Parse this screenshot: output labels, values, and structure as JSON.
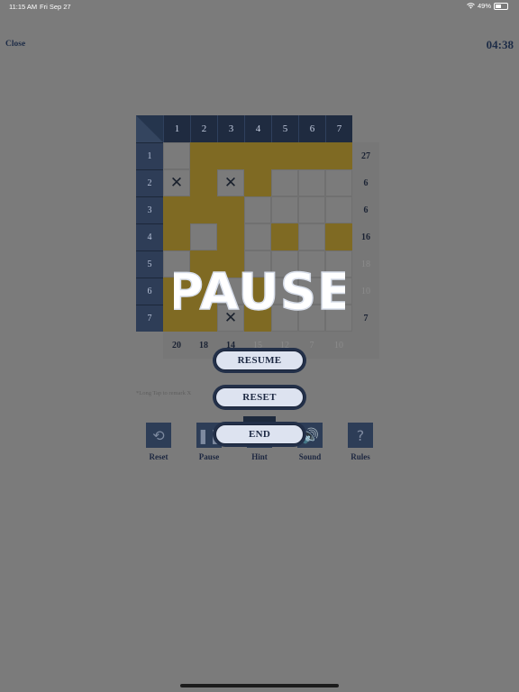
{
  "status_bar": {
    "time": "11:15 AM",
    "date": "Fri Sep 27",
    "battery": "49%",
    "battery_level": 0.49
  },
  "header": {
    "close_label": "Close",
    "timer": "04:38"
  },
  "grid": {
    "col_headers": [
      "1",
      "2",
      "3",
      "4",
      "5",
      "6",
      "7"
    ],
    "row_headers": [
      "1",
      "2",
      "3",
      "4",
      "5",
      "6",
      "7"
    ],
    "row_sums": [
      "27",
      "6",
      "6",
      "16",
      "18",
      "10",
      "7"
    ],
    "row_sums_dim": [
      false,
      false,
      false,
      false,
      true,
      true,
      false
    ],
    "col_sums": [
      "20",
      "18",
      "14",
      "15",
      "12",
      "7",
      "10"
    ],
    "col_sums_dim": [
      false,
      false,
      false,
      true,
      true,
      true,
      true
    ],
    "cells": [
      [
        0,
        1,
        1,
        1,
        1,
        1,
        1
      ],
      [
        2,
        1,
        2,
        1,
        0,
        0,
        0
      ],
      [
        1,
        1,
        1,
        0,
        0,
        0,
        0
      ],
      [
        1,
        0,
        1,
        0,
        1,
        0,
        1
      ],
      [
        0,
        1,
        1,
        0,
        0,
        0,
        0
      ],
      [
        1,
        1,
        0,
        1,
        0,
        0,
        0
      ],
      [
        1,
        1,
        2,
        1,
        0,
        0,
        0
      ]
    ]
  },
  "note": "*Long Tap to remark X",
  "toolbar": [
    {
      "label": "Reset",
      "icon": "reset-icon",
      "glyph": "⟲"
    },
    {
      "label": "Pause",
      "icon": "pause-icon",
      "glyph": "❚❚"
    },
    {
      "label": "Hint",
      "icon": "hint-icon",
      "glyph": ""
    },
    {
      "label": "Sound",
      "icon": "sound-icon",
      "glyph": "🔊"
    },
    {
      "label": "Rules",
      "icon": "rules-icon",
      "glyph": "?"
    }
  ],
  "pause_menu": {
    "title": "PAUSE",
    "resume_label": "RESUME",
    "reset_label": "RESET",
    "end_label": "END"
  },
  "colors": {
    "filled": "#7f6a23",
    "header": "#1f2b40",
    "overlay": "#7b7b7b",
    "button_face": "#dde3f0"
  }
}
